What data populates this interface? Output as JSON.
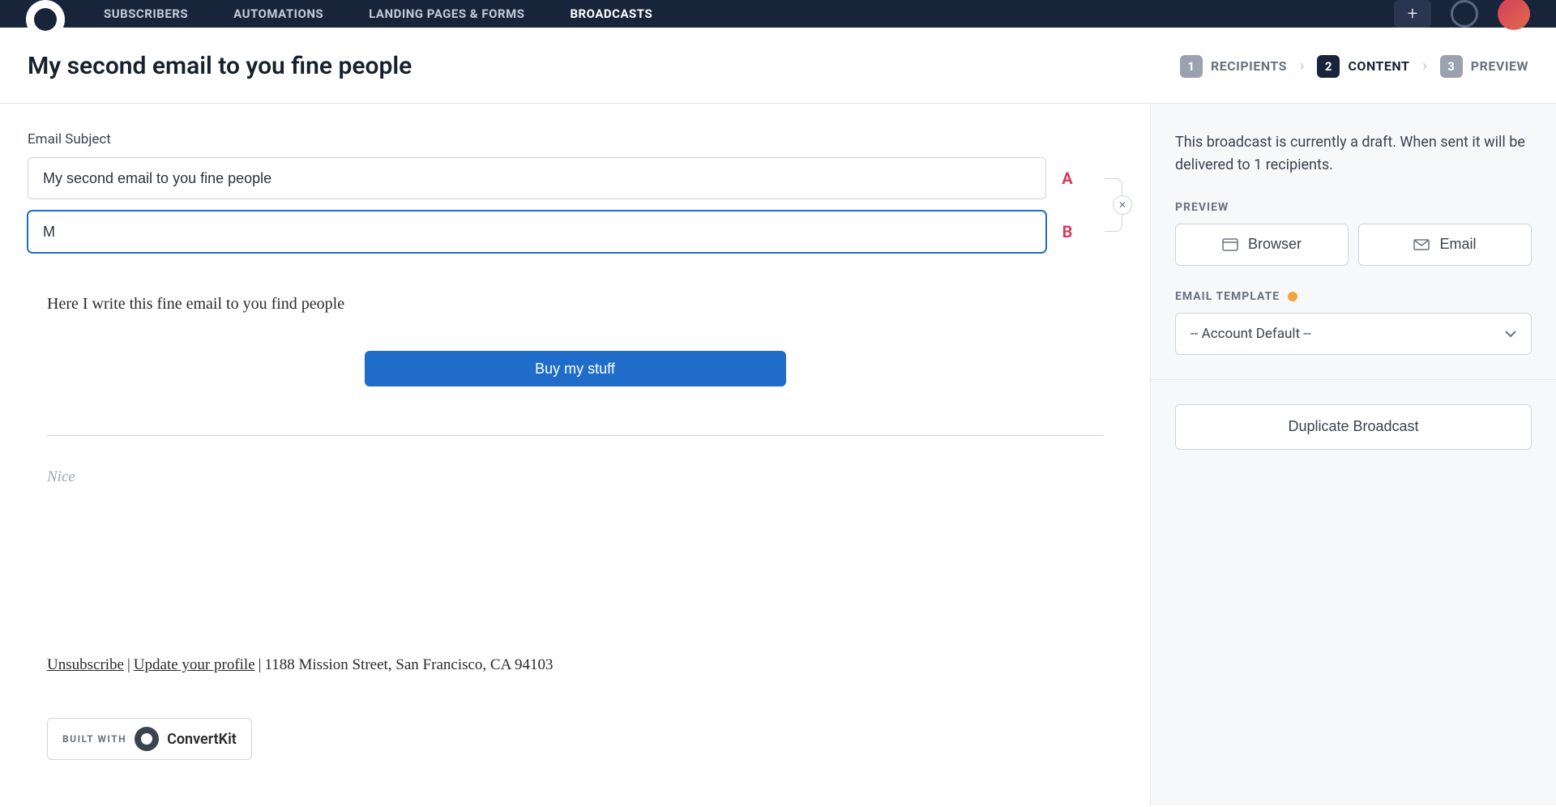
{
  "nav": {
    "items": [
      "SUBSCRIBERS",
      "AUTOMATIONS",
      "LANDING PAGES & FORMS",
      "BROADCASTS"
    ],
    "active": 3,
    "plus": "+"
  },
  "title": "My second email to you fine people",
  "steps": [
    {
      "num": "1",
      "label": "RECIPIENTS"
    },
    {
      "num": "2",
      "label": "CONTENT"
    },
    {
      "num": "3",
      "label": "PREVIEW"
    }
  ],
  "activeStep": 1,
  "subject": {
    "label": "Email Subject",
    "a": "My second email to you fine people",
    "b": "M",
    "letterA": "A",
    "letterB": "B",
    "remove": "✕"
  },
  "body": {
    "text": "Here I write this fine email to you find people",
    "cta": "Buy my stuff",
    "signature": "Nice"
  },
  "footer": {
    "unsubscribe": "Unsubscribe",
    "update": "Update your profile",
    "address": "1188 Mission Street, San Francisco, CA 94103"
  },
  "builtwith": {
    "label": "BUILT WITH",
    "brand": "ConvertKit"
  },
  "sidebar": {
    "note": "This broadcast is currently a draft. When sent it will be delivered to 1 recipients.",
    "previewLabel": "PREVIEW",
    "browser": "Browser",
    "email": "Email",
    "templateLabel": "EMAIL TEMPLATE",
    "templateValue": "-- Account Default --",
    "duplicate": "Duplicate Broadcast"
  }
}
